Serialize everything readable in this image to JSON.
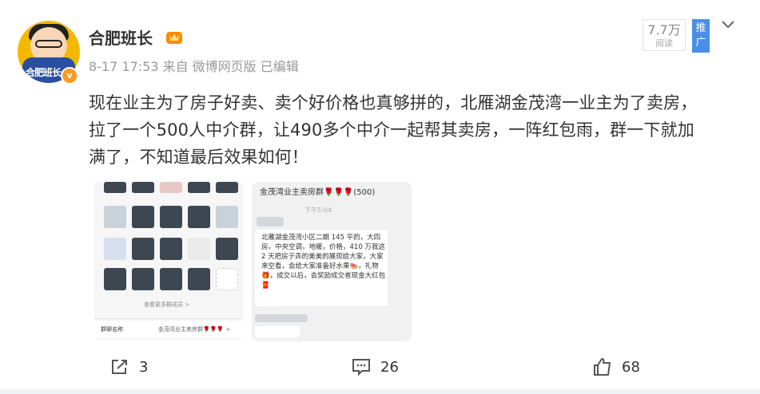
{
  "user": {
    "name": "合肥班长",
    "avatar_text": "合肥班长",
    "badge": "v"
  },
  "post": {
    "meta": "8-17 17:53 来自 微博网页版 已编辑",
    "read_count": "7.7万",
    "read_label": "阅读",
    "promo_label_1": "推",
    "promo_label_2": "广",
    "content_lines": [
      "现在业主为了房子好卖、卖个好价格也真够拼的，北雁湖金茂湾一业主为了卖房，",
      "拉了一个500人中介群，让490多个中介一起帮其卖房，一阵红包雨，群一下就加",
      "满了，不知道最后效果如何！"
    ]
  },
  "image1": {
    "more_members": "查看更多群成员 >",
    "group_name_label": "群聊名称",
    "group_name_value": "金茂湾业主卖房群🌹🌹🌹 >"
  },
  "image2": {
    "header": "金茂湾业主卖房群🌹🌹🌹(500)",
    "time": "下午5:04",
    "message": "北雁湖金茂湾小区二期 145 平的，大四房，中央空调，地暖，价格，410 万我这 2 天把房子弄的美美的展现给大家，大家来空看，会给大家准备好水果🍉，礼物🎁，成交以后，会奖励成交者现金大红包🧧"
  },
  "actions": {
    "share_count": "3",
    "comment_count": "26",
    "like_count": "68"
  }
}
